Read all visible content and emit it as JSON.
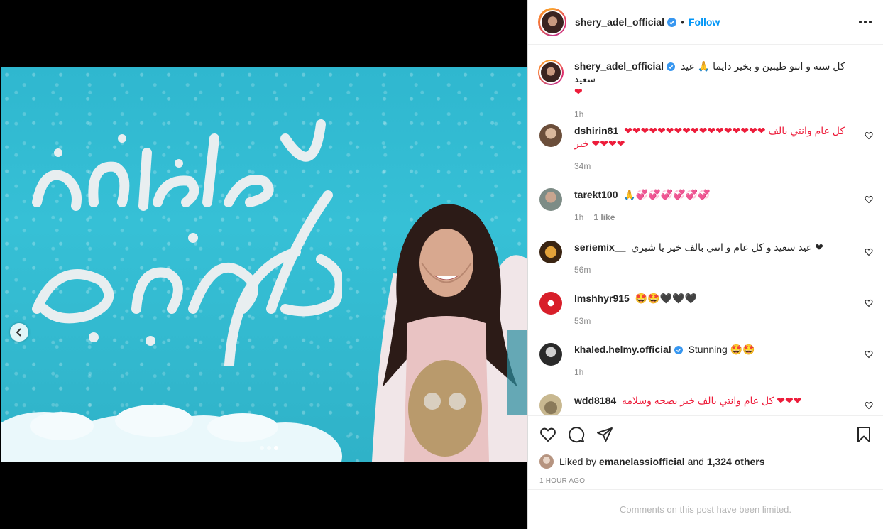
{
  "post": {
    "username": "shery_adel_official",
    "follow_label": "Follow",
    "separator": "•",
    "caption": "كل سنة و انتو طيبين و بخير دايما 🙏 عيد سعيد",
    "caption_emoji": "❤",
    "caption_time": "1h",
    "carousel": {
      "total_slides": 3,
      "active_slide": 3
    },
    "image_text": {
      "line1": "كل عام وأنتم بخير",
      "line2": "عيد سعيد"
    }
  },
  "comments": [
    {
      "username": "dshirin81",
      "text": "❤❤❤❤❤❤❤❤❤❤❤❤❤❤❤❤❤ كل عام وانتي بالف خير ❤❤❤❤",
      "time": "34m",
      "likes": ""
    },
    {
      "username": "tarekt100",
      "text": "🙏💞💞💞💞💞💞",
      "time": "1h",
      "likes": "1 like"
    },
    {
      "username": "seriemix__",
      "text": "عيد سعيد و كل عام و انتي بالف خير يا شيري ❤",
      "time": "56m",
      "likes": ""
    },
    {
      "username": "lmshhyr915",
      "text": "🤩🤩🖤🖤🖤",
      "time": "53m",
      "likes": ""
    },
    {
      "username": "khaled.helmy.official",
      "text": "Stunning 🤩🤩",
      "time": "1h",
      "likes": "",
      "verified": true
    },
    {
      "username": "wdd8184",
      "text": "كل عام وانتي بالف خير بصحه وسلامه ❤❤❤",
      "time": "",
      "likes": ""
    }
  ],
  "likes": {
    "prefix": "Liked by",
    "first_user": "emanelassiofficial",
    "conj": "and",
    "others": "1,324 others"
  },
  "timestamp": "1 HOUR AGO",
  "limited_notice": "Comments on this post have been limited.",
  "colors": {
    "accent": "#0095f6",
    "verified": "#3897f0",
    "heart_red": "#ed1c3a",
    "muted": "#8e8e8e",
    "photo_bg": "#36c0d6"
  },
  "icons": [
    "chevron-left-icon",
    "verified-icon",
    "more-icon",
    "heart-outline-icon",
    "comment-icon",
    "share-icon",
    "bookmark-icon"
  ]
}
